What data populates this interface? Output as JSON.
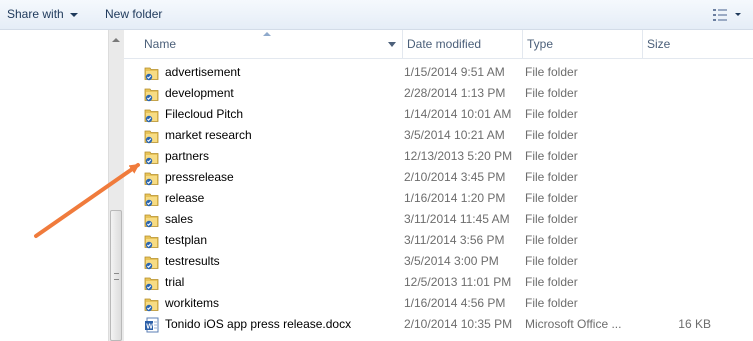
{
  "toolbar": {
    "share_label": "Share with",
    "new_folder_label": "New folder",
    "view_icon": "view-options-icon"
  },
  "columns": {
    "name": "Name",
    "date": "Date modified",
    "type": "Type",
    "size": "Size"
  },
  "files": [
    {
      "name": "advertisement",
      "date": "1/15/2014 9:51 AM",
      "type": "File folder",
      "size": "",
      "icon": "folder-icon"
    },
    {
      "name": "development",
      "date": "2/28/2014 1:13 PM",
      "type": "File folder",
      "size": "",
      "icon": "folder-icon"
    },
    {
      "name": "Filecloud Pitch",
      "date": "1/14/2014 10:01 AM",
      "type": "File folder",
      "size": "",
      "icon": "folder-icon"
    },
    {
      "name": "market research",
      "date": "3/5/2014 10:21 AM",
      "type": "File folder",
      "size": "",
      "icon": "folder-icon"
    },
    {
      "name": "partners",
      "date": "12/13/2013 5:20 PM",
      "type": "File folder",
      "size": "",
      "icon": "folder-icon"
    },
    {
      "name": "pressrelease",
      "date": "2/10/2014 3:45 PM",
      "type": "File folder",
      "size": "",
      "icon": "folder-icon"
    },
    {
      "name": "release",
      "date": "1/16/2014 1:20 PM",
      "type": "File folder",
      "size": "",
      "icon": "folder-icon"
    },
    {
      "name": "sales",
      "date": "3/11/2014 11:45 AM",
      "type": "File folder",
      "size": "",
      "icon": "folder-icon"
    },
    {
      "name": "testplan",
      "date": "3/11/2014 3:56 PM",
      "type": "File folder",
      "size": "",
      "icon": "folder-icon"
    },
    {
      "name": "testresults",
      "date": "3/5/2014 3:00 PM",
      "type": "File folder",
      "size": "",
      "icon": "folder-icon"
    },
    {
      "name": "trial",
      "date": "12/5/2013 11:01 PM",
      "type": "File folder",
      "size": "",
      "icon": "folder-icon"
    },
    {
      "name": "workitems",
      "date": "1/16/2014 4:56 PM",
      "type": "File folder",
      "size": "",
      "icon": "folder-icon"
    },
    {
      "name": "Tonido iOS app press release.docx",
      "date": "2/10/2014 10:35 PM",
      "type": "Microsoft Office ...",
      "size": "16 KB",
      "icon": "word-document-icon"
    }
  ],
  "annotation": {
    "color": "#f07b3c",
    "target": "partners"
  }
}
